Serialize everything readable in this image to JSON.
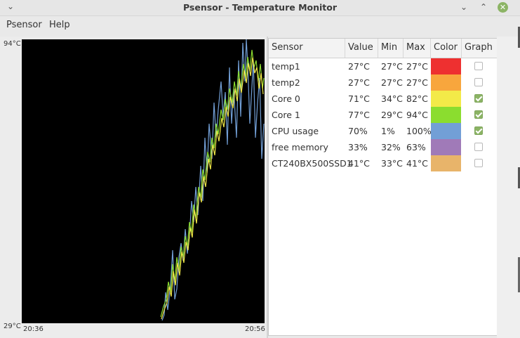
{
  "window": {
    "title": "Psensor - Temperature Monitor"
  },
  "titlebar": {
    "menu_icon": "chevron-down-icon",
    "min_icon": "minimize-icon",
    "max_icon": "maximize-icon",
    "close_icon": "close-icon"
  },
  "menu": {
    "items": [
      "Psensor",
      "Help"
    ]
  },
  "graph": {
    "y_max_label": "94°C",
    "y_min_label": "29°C",
    "x_start_label": "20:36",
    "x_end_label": "20:56"
  },
  "table": {
    "headers": [
      "Sensor",
      "Value",
      "Min",
      "Max",
      "Color",
      "Graph"
    ],
    "rows": [
      {
        "sensor": "temp1",
        "value": "27°C",
        "min": "27°C",
        "max": "27°C",
        "color": "#ee3030",
        "graph": false
      },
      {
        "sensor": "temp2",
        "value": "27°C",
        "min": "27°C",
        "max": "27°C",
        "color": "#f8a63d",
        "graph": false
      },
      {
        "sensor": "Core 0",
        "value": "71°C",
        "min": "34°C",
        "max": "82°C",
        "color": "#f3ea48",
        "graph": true
      },
      {
        "sensor": "Core 1",
        "value": "77°C",
        "min": "29°C",
        "max": "94°C",
        "color": "#8bdd2f",
        "graph": true
      },
      {
        "sensor": "CPU usage",
        "value": "70%",
        "min": "1%",
        "max": "100%",
        "color": "#729fd6",
        "graph": true
      },
      {
        "sensor": "free memory",
        "value": "33%",
        "min": "32%",
        "max": "63%",
        "color": "#a07ab8",
        "graph": false
      },
      {
        "sensor": "CT240BX500SSD1",
        "value": "41°C",
        "min": "33°C",
        "max": "41°C",
        "color": "#e8b46a",
        "graph": false
      }
    ]
  }
}
